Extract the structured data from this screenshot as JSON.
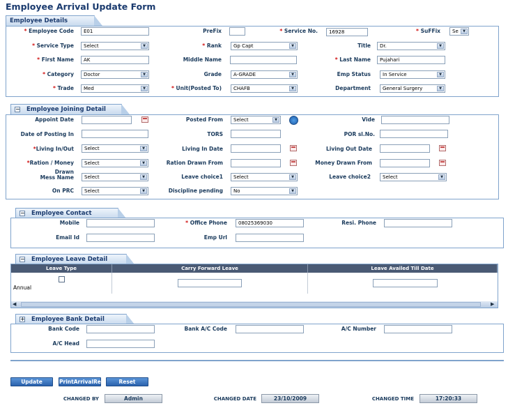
{
  "page_title": "Employee Arrival Update Form",
  "details": {
    "tab": "Employee Details",
    "employee_code_label": "Employee Code",
    "employee_code": "E01",
    "prefix_label": "PreFix",
    "prefix": "",
    "service_no_label": "Service No.",
    "service_no": "16928",
    "suffix_label": "SuFFix",
    "suffix": "Se",
    "service_type_label": "Service Type",
    "service_type": "Select",
    "rank_label": "Rank",
    "rank": "Gp Capt",
    "title_label": "Title",
    "title": "Dr.",
    "first_name_label": "First Name",
    "first_name": "AK",
    "middle_name_label": "Middle Name",
    "middle_name": "",
    "last_name_label": "Last Name",
    "last_name": "Pujahari",
    "category_label": "Category",
    "category": "Doctor",
    "grade_label": "Grade",
    "grade": "A-GRADE",
    "emp_status_label": "Emp Status",
    "emp_status": "In Service",
    "trade_label": "Trade",
    "trade": "Med",
    "unit_label": "Unit(Posted To)",
    "unit": "CHAFB",
    "department_label": "Department",
    "department": "General Surgery"
  },
  "joining": {
    "tab": "Employee Joining Detail",
    "appoint_date_label": "Appoint Date",
    "appoint_date": "",
    "posted_from_label": "Posted From",
    "posted_from": "Select",
    "vide_label": "Vide",
    "vide": "",
    "date_posting_label": "Date of Posting In",
    "date_posting": "",
    "tors_label": "TORS",
    "tors": "",
    "por_label": "POR sl.No.",
    "por": "",
    "living_label": "Living In/Out",
    "living": "Select",
    "living_in_date_label": "Living In Date",
    "living_in_date": "",
    "living_out_date_label": "Living Out Date",
    "living_out_date": "",
    "ration_label": "Ration / Money",
    "ration": "Select",
    "ration_drawn_label": "Ration Drawn From",
    "ration_drawn": "",
    "money_drawn_label": "Money Drawn From",
    "money_drawn": "",
    "mess_label_1": "Drawn",
    "mess_label_2": "Mess Name",
    "mess": "Select",
    "leave_choice1_label": "Leave choice1",
    "leave_choice1": "Select",
    "leave_choice2_label": "Leave choice2",
    "leave_choice2": "Select",
    "on_prc_label": "On PRC",
    "on_prc": "Select",
    "discipline_label": "Discipline pending",
    "discipline": "No"
  },
  "contact": {
    "tab": "Employee Contact",
    "mobile_label": "Mobile",
    "mobile": "",
    "office_phone_label": "Office Phone",
    "office_phone": "08025369030",
    "resi_phone_label": "Resi. Phone",
    "resi_phone": "",
    "email_label": "Email Id",
    "email": "",
    "url_label": "Emp Url",
    "url": ""
  },
  "leave": {
    "tab": "Employee Leave Detail",
    "columns": [
      "Leave Type",
      "Carry Forward Leave",
      "Leave Availed Till Date"
    ],
    "row_type": "Annual"
  },
  "bank": {
    "tab": "Employee Bank Detail",
    "bank_code_label": "Bank Code",
    "bank_ac_code_label": "Bank A/C Code",
    "ac_number_label": "A/C Number",
    "ac_head_label": "A/C Head"
  },
  "buttons": {
    "update": "Update",
    "print": "PrintArrivalRe",
    "reset": "Reset"
  },
  "footer": {
    "changed_by_label": "CHANGED BY",
    "changed_by": "Admin",
    "changed_date_label": "CHANGED DATE",
    "changed_date": "23/10/2009",
    "changed_time_label": "CHANGED TIME",
    "changed_time": "17:20:33"
  },
  "colors": {
    "required": "#d01010",
    "header": "#1a3a6e",
    "button": "#2b62ad"
  }
}
